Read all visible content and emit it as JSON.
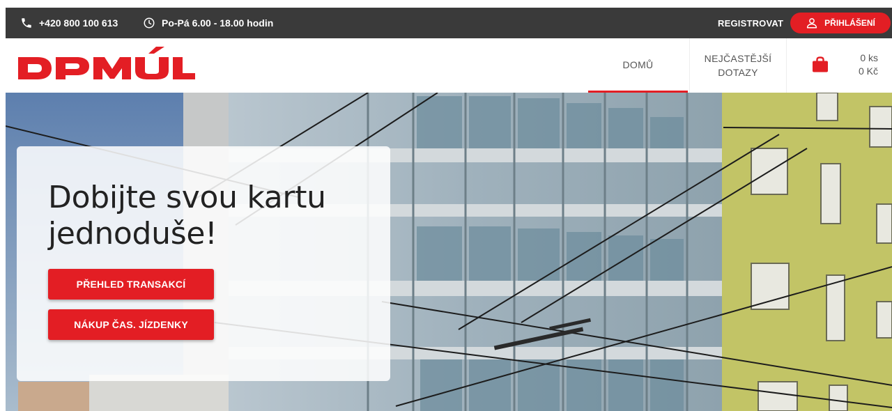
{
  "topbar": {
    "phone": "+420 800 100 613",
    "phone_icon": "phone-icon",
    "hours": "Po-Pá 6.00 - 18.00 hodin",
    "hours_icon": "clock-icon",
    "register_label": "REGISTROVAT",
    "login_label": "PŘIHLÁŠENÍ",
    "login_icon": "user-icon",
    "bg_color": "#3a3a3a"
  },
  "header": {
    "logo_text": "DPMÚL",
    "nav": [
      {
        "label": "DOMŮ",
        "active": true
      },
      {
        "label": "NEJČASTĚJŠÍ DOTAZY",
        "active": false
      }
    ],
    "cart": {
      "icon": "shopping-bag-icon",
      "count": "0 ks",
      "price": "0 Kč"
    }
  },
  "hero": {
    "title": "Dobijte svou kartu jednoduše!",
    "buttons": [
      "PŘEHLED TRANSAKCÍ",
      "NÁKUP ČAS. JÍZDENKY"
    ]
  },
  "colors": {
    "accent": "#e31e24",
    "text_dark": "#222222",
    "nav_text": "#555555"
  }
}
